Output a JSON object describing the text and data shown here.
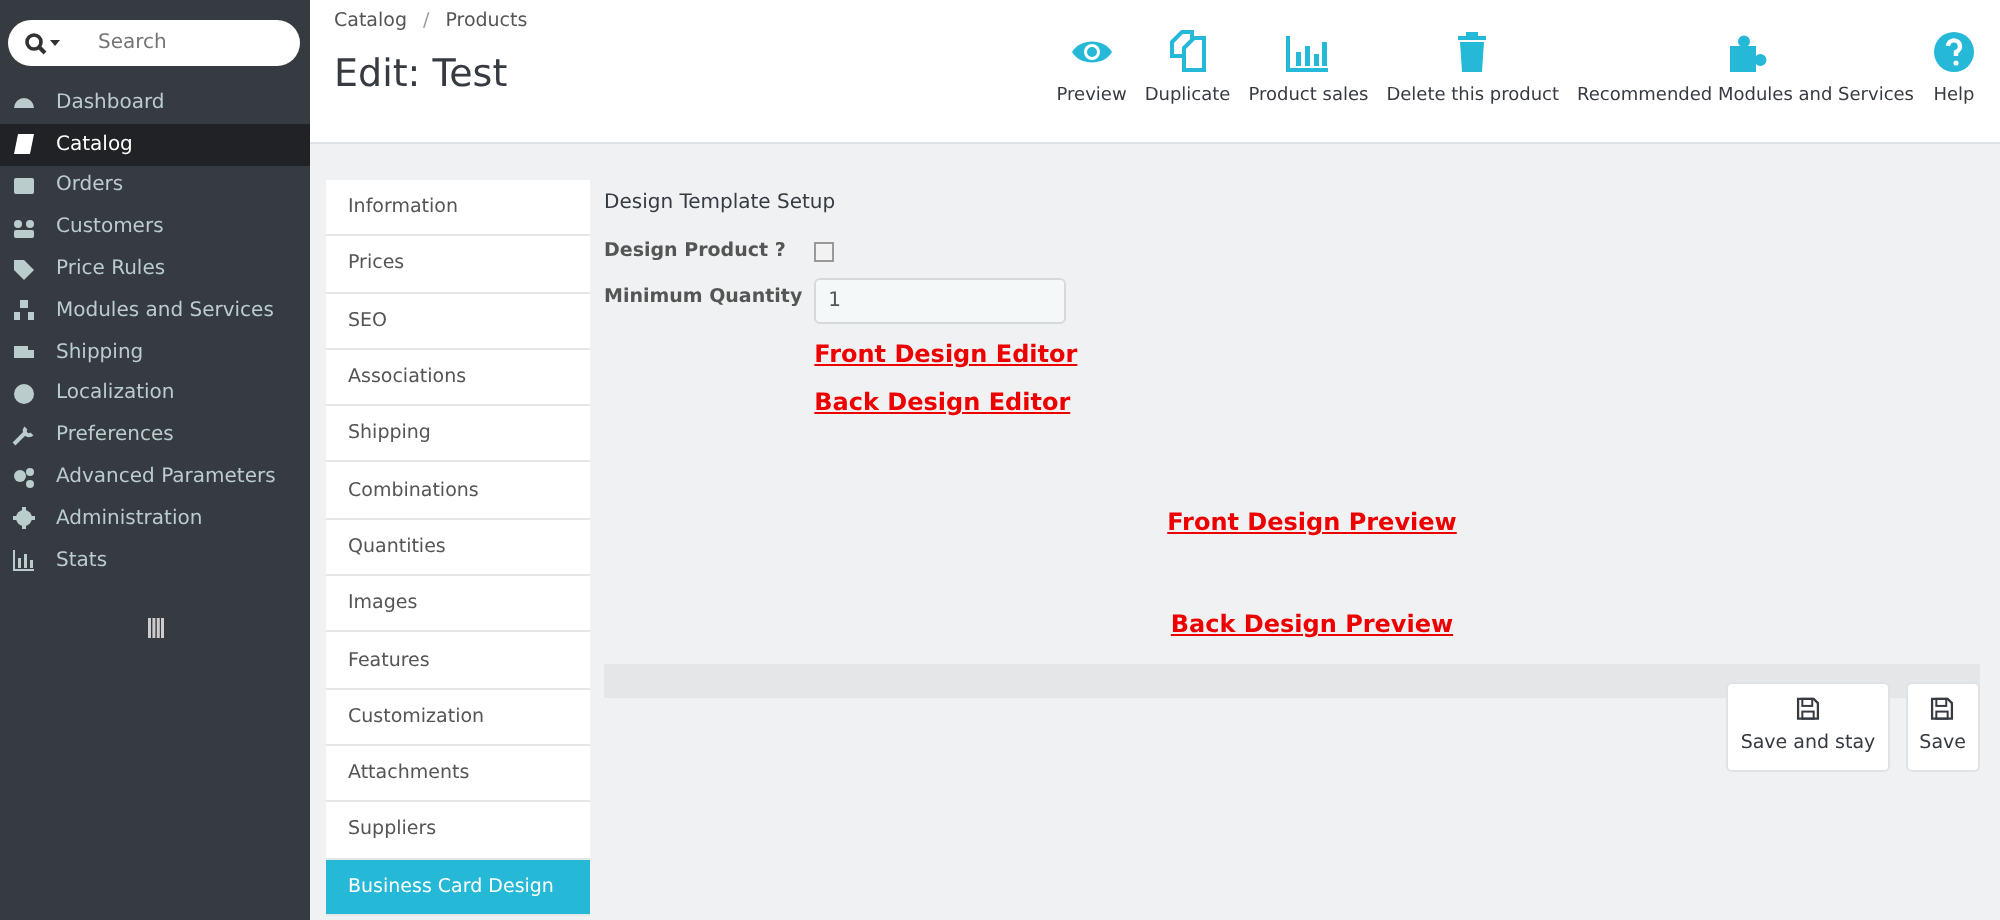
{
  "sidebar": {
    "search": {
      "placeholder": "Search"
    },
    "items": [
      {
        "label": "Dashboard",
        "selected": false
      },
      {
        "label": "Catalog",
        "selected": true
      },
      {
        "label": "Orders",
        "selected": false
      },
      {
        "label": "Customers",
        "selected": false
      },
      {
        "label": "Price Rules",
        "selected": false
      },
      {
        "label": "Modules and Services",
        "selected": false
      },
      {
        "label": "Shipping",
        "selected": false
      },
      {
        "label": "Localization",
        "selected": false
      },
      {
        "label": "Preferences",
        "selected": false
      },
      {
        "label": "Advanced Parameters",
        "selected": false
      },
      {
        "label": "Administration",
        "selected": false
      },
      {
        "label": "Stats",
        "selected": false
      }
    ]
  },
  "header": {
    "breadcrumb": [
      "Catalog",
      "Products"
    ],
    "breadcrumb_separator": "/",
    "title": "Edit: Test",
    "toolbar": [
      {
        "label": "Preview"
      },
      {
        "label": "Duplicate"
      },
      {
        "label": "Product sales"
      },
      {
        "label": "Delete this product"
      },
      {
        "label": "Recommended Modules and Services"
      },
      {
        "label": "Help"
      }
    ]
  },
  "tabs": [
    {
      "label": "Information",
      "selected": false
    },
    {
      "label": "Prices",
      "selected": false
    },
    {
      "label": "SEO",
      "selected": false
    },
    {
      "label": "Associations",
      "selected": false
    },
    {
      "label": "Shipping",
      "selected": false
    },
    {
      "label": "Combinations",
      "selected": false
    },
    {
      "label": "Quantities",
      "selected": false
    },
    {
      "label": "Images",
      "selected": false
    },
    {
      "label": "Features",
      "selected": false
    },
    {
      "label": "Customization",
      "selected": false
    },
    {
      "label": "Attachments",
      "selected": false
    },
    {
      "label": "Suppliers",
      "selected": false
    },
    {
      "label": "Business Card Design",
      "selected": true
    }
  ],
  "form": {
    "heading": "Design Template Setup",
    "design_product": {
      "label": "Design Product ?",
      "checked": false
    },
    "minimum_quantity": {
      "label": "Minimum Quantity",
      "value": "1"
    },
    "editor_links": [
      "Front Design Editor",
      "Back Design Editor"
    ],
    "preview_links": [
      "Front Design Preview",
      "Back Design Preview"
    ],
    "buttons": [
      {
        "label": "Save and stay"
      },
      {
        "label": "Save"
      }
    ]
  }
}
